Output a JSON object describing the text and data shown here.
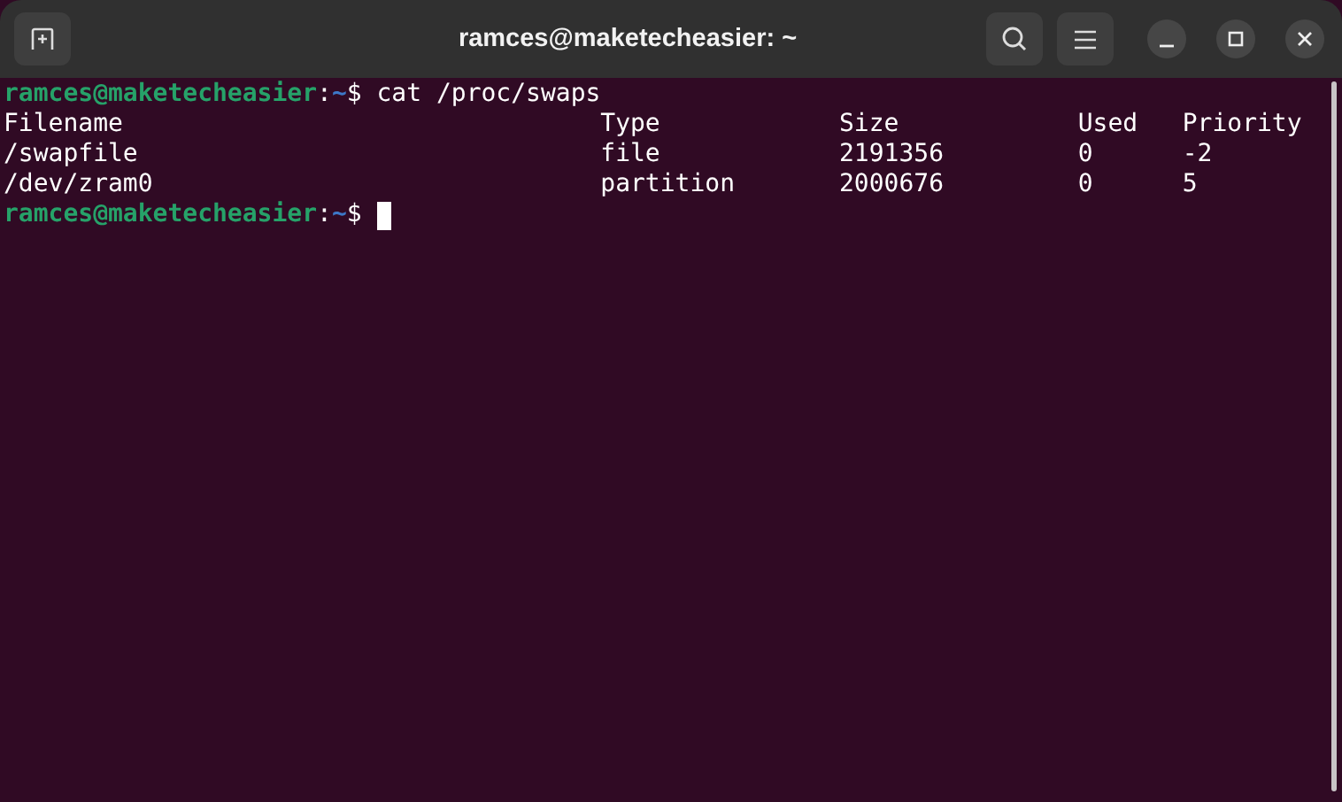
{
  "window": {
    "title": "ramces@maketecheasier: ~"
  },
  "terminal": {
    "lines": [
      {
        "kind": "prompt",
        "user_host": "ramces@maketecheasier",
        "separator": ":",
        "path": "~",
        "symbol": "$",
        "command": "cat /proc/swaps",
        "cursor": false
      },
      {
        "kind": "row",
        "cells": [
          "Filename",
          "Type",
          "Size",
          "Used",
          "Priority"
        ]
      },
      {
        "kind": "row",
        "cells": [
          "/swapfile",
          "file",
          "2191356",
          "0",
          "-2"
        ]
      },
      {
        "kind": "row",
        "cells": [
          "/dev/zram0",
          "partition",
          "2000676",
          "0",
          "5"
        ]
      },
      {
        "kind": "prompt",
        "user_host": "ramces@maketecheasier",
        "separator": ":",
        "path": "~",
        "symbol": "$",
        "cursor": true
      }
    ]
  }
}
